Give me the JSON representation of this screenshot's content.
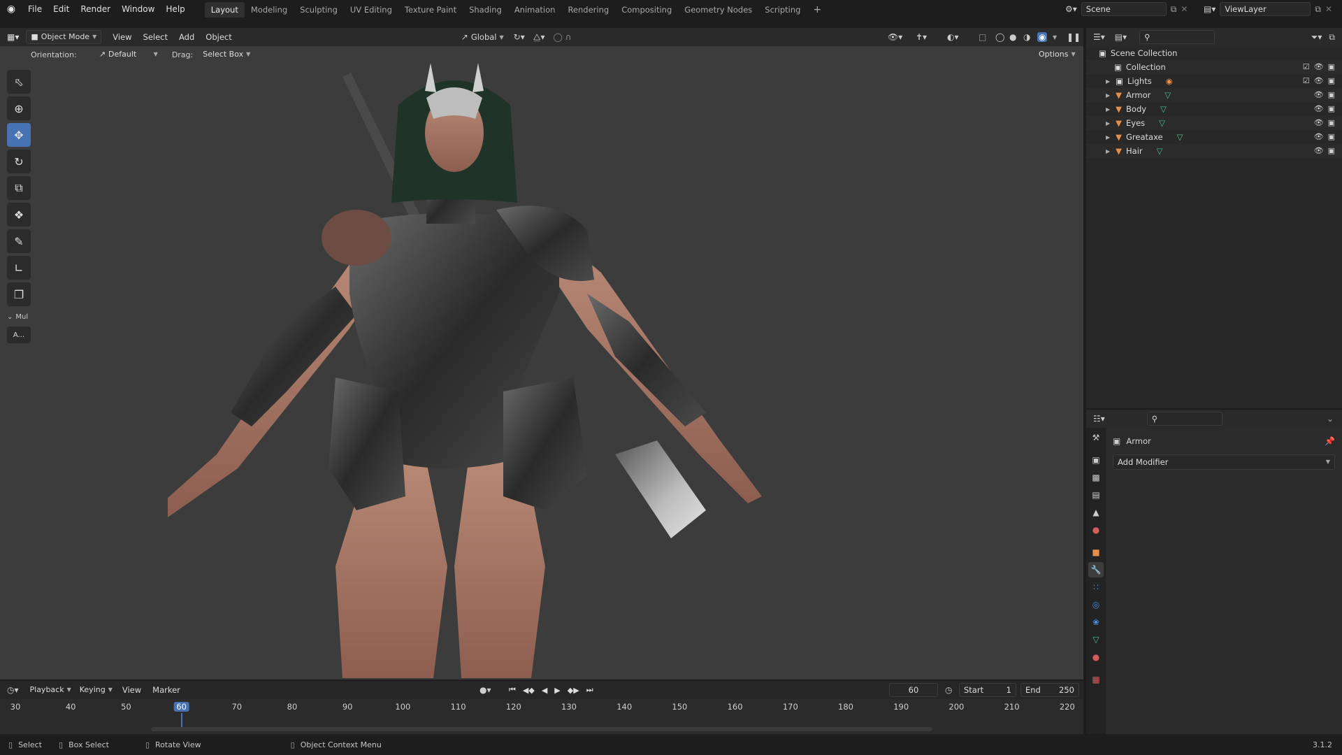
{
  "menus": [
    "File",
    "Edit",
    "Render",
    "Window",
    "Help"
  ],
  "workspaces": [
    "Layout",
    "Modeling",
    "Sculpting",
    "UV Editing",
    "Texture Paint",
    "Shading",
    "Animation",
    "Rendering",
    "Compositing",
    "Geometry Nodes",
    "Scripting"
  ],
  "active_workspace": "Layout",
  "scene": {
    "label": "Scene",
    "view_layer": "ViewLayer"
  },
  "viewport_header": {
    "mode": "Object Mode",
    "view": "View",
    "select": "Select",
    "add": "Add",
    "object": "Object",
    "transform": "Global"
  },
  "tool_header": {
    "orientation_label": "Orientation:",
    "orientation_value": "Default",
    "drag_label": "Drag:",
    "drag_value": "Select Box",
    "options": "Options"
  },
  "toolbar": {
    "collapsed_label": "Mul",
    "sub_label": "A..."
  },
  "outliner": {
    "root": "Scene Collection",
    "collection": "Collection",
    "items": [
      {
        "name": "Lights",
        "type": "light"
      },
      {
        "name": "Armor",
        "type": "mesh"
      },
      {
        "name": "Body",
        "type": "mesh"
      },
      {
        "name": "Eyes",
        "type": "mesh"
      },
      {
        "name": "Greataxe",
        "type": "mesh"
      },
      {
        "name": "Hair",
        "type": "mesh"
      }
    ]
  },
  "properties": {
    "object_name": "Armor",
    "add_modifier": "Add Modifier"
  },
  "timeline": {
    "playback": "Playback",
    "keying": "Keying",
    "view": "View",
    "marker": "Marker",
    "current_frame": "60",
    "start_label": "Start",
    "start": "1",
    "end_label": "End",
    "end": "250",
    "ticks": [
      "30",
      "40",
      "50",
      "60",
      "70",
      "80",
      "90",
      "100",
      "110",
      "120",
      "130",
      "140",
      "150",
      "160",
      "170",
      "180",
      "190",
      "200",
      "210",
      "220"
    ]
  },
  "status": {
    "select": "Select",
    "box_select": "Box Select",
    "rotate_view": "Rotate View",
    "context_menu": "Object Context Menu",
    "version": "3.1.2"
  },
  "colors": {
    "accent": "#4772b3",
    "mesh": "#e8904a",
    "tick_active": "#4772b3"
  }
}
